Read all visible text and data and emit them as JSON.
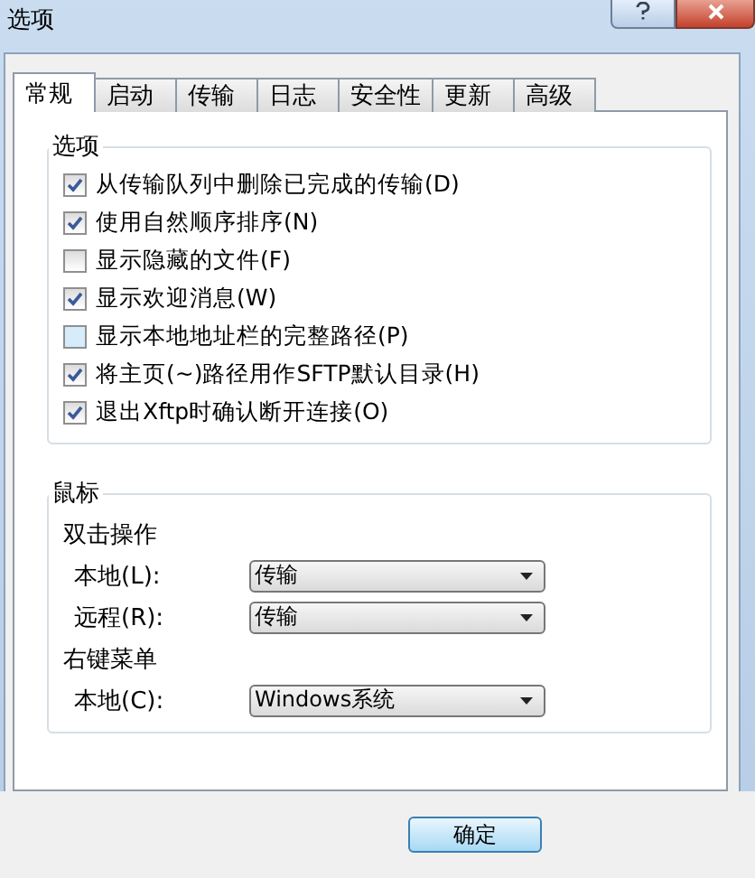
{
  "window": {
    "title": "选项"
  },
  "tabs": [
    {
      "label": "常规",
      "selected": true
    },
    {
      "label": "启动",
      "selected": false
    },
    {
      "label": "传输",
      "selected": false
    },
    {
      "label": "日志",
      "selected": false
    },
    {
      "label": "安全性",
      "selected": false
    },
    {
      "label": "更新",
      "selected": false
    },
    {
      "label": "高级",
      "selected": false
    }
  ],
  "options": {
    "title": "选项",
    "items": [
      {
        "label": "从传输队列中删除已完成的传输(D)",
        "checked": true
      },
      {
        "label": "使用自然顺序排序(N)",
        "checked": true
      },
      {
        "label": "显示隐藏的文件(F)",
        "checked": false
      },
      {
        "label": "显示欢迎消息(W)",
        "checked": true
      },
      {
        "label": "显示本地地址栏的完整路径(P)",
        "checked": false
      },
      {
        "label": "将主页(~)路径用作SFTP默认目录(H)",
        "checked": true
      },
      {
        "label": "退出Xftp时确认断开连接(O)",
        "checked": true
      }
    ]
  },
  "mouse": {
    "title": "鼠标",
    "sections": [
      {
        "title": "双击操作",
        "rows": [
          {
            "label": "本地(L):",
            "value": "传输"
          },
          {
            "label": "远程(R):",
            "value": "传输"
          }
        ]
      },
      {
        "title": "右键菜单",
        "rows": [
          {
            "label": "本地(C):",
            "value": "Windows系统"
          }
        ]
      }
    ]
  },
  "buttons": [
    "确定"
  ]
}
